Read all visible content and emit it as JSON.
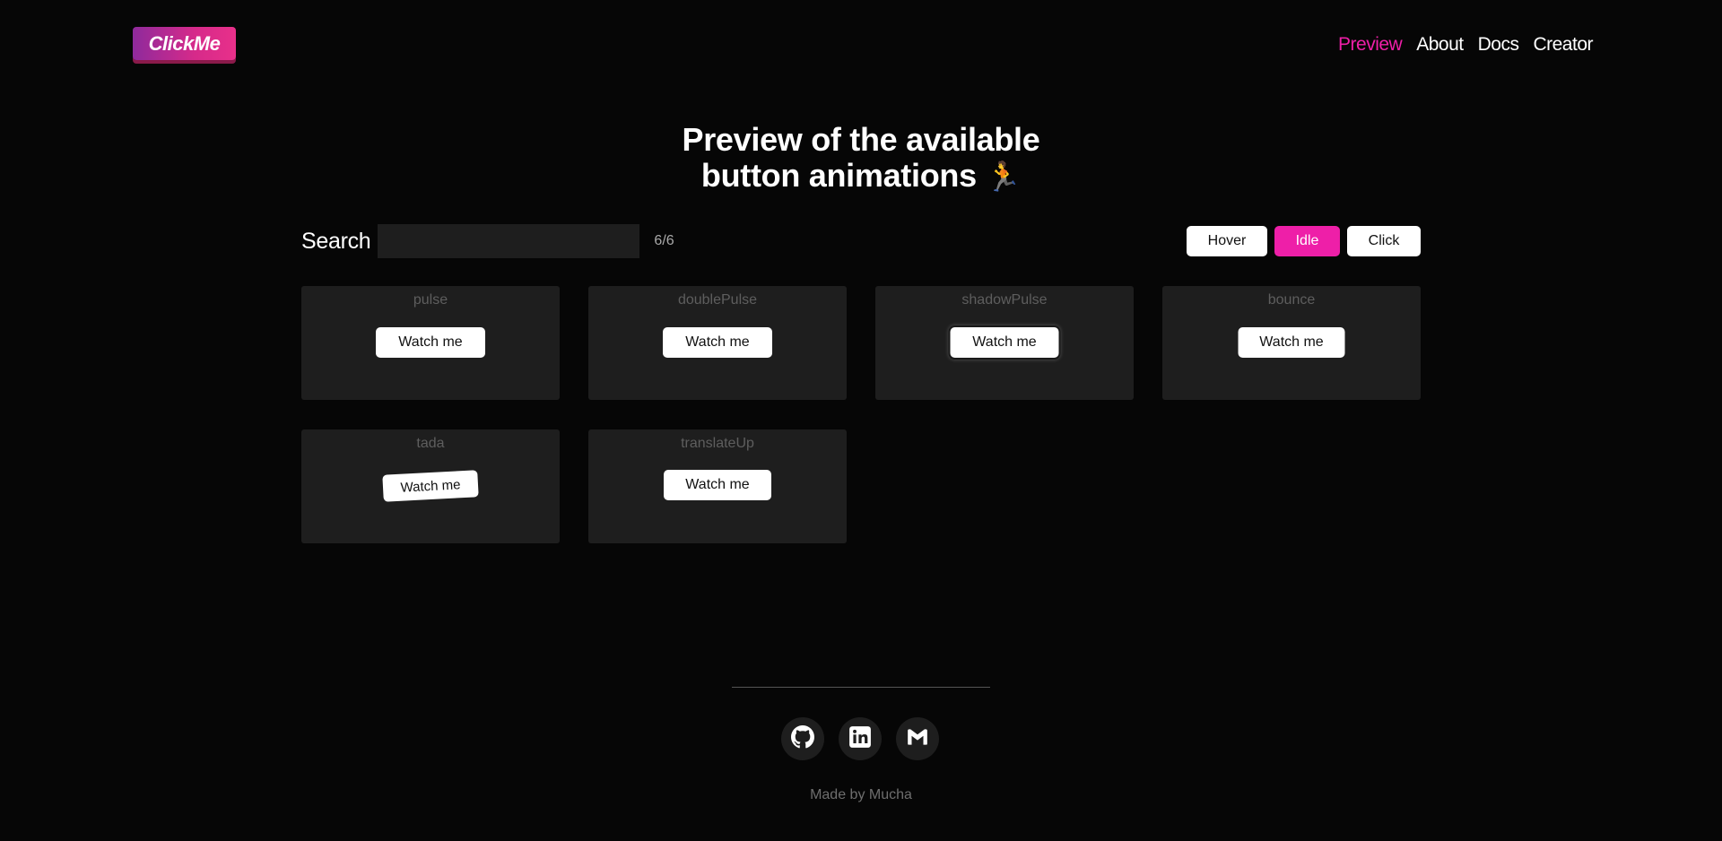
{
  "header": {
    "logo": "ClickMe",
    "nav": [
      {
        "label": "Preview",
        "active": true
      },
      {
        "label": "About",
        "active": false
      },
      {
        "label": "Docs",
        "active": false
      },
      {
        "label": "Creator",
        "active": false
      }
    ]
  },
  "hero": {
    "title_line1": "Preview of the available",
    "title_line2": "button animations",
    "title_emoji": "🏃"
  },
  "search": {
    "label": "Search",
    "value": "",
    "placeholder": "",
    "count": "6/6"
  },
  "modes": {
    "options": [
      "Hover",
      "Idle",
      "Click"
    ],
    "selected": "Idle"
  },
  "cards": [
    {
      "name": "pulse",
      "button": "Watch me"
    },
    {
      "name": "doublePulse",
      "button": "Watch me"
    },
    {
      "name": "shadowPulse",
      "button": "Watch me"
    },
    {
      "name": "bounce",
      "button": "Watch me"
    },
    {
      "name": "tada",
      "button": "Watch me"
    },
    {
      "name": "translateUp",
      "button": "Watch me"
    }
  ],
  "footer": {
    "icons": [
      "github-icon",
      "linkedin-icon",
      "gmail-icon"
    ],
    "credit": "Made by Mucha"
  },
  "colors": {
    "background": "#060606",
    "accent": "#ee1fa8",
    "card": "#1e1e1e"
  }
}
